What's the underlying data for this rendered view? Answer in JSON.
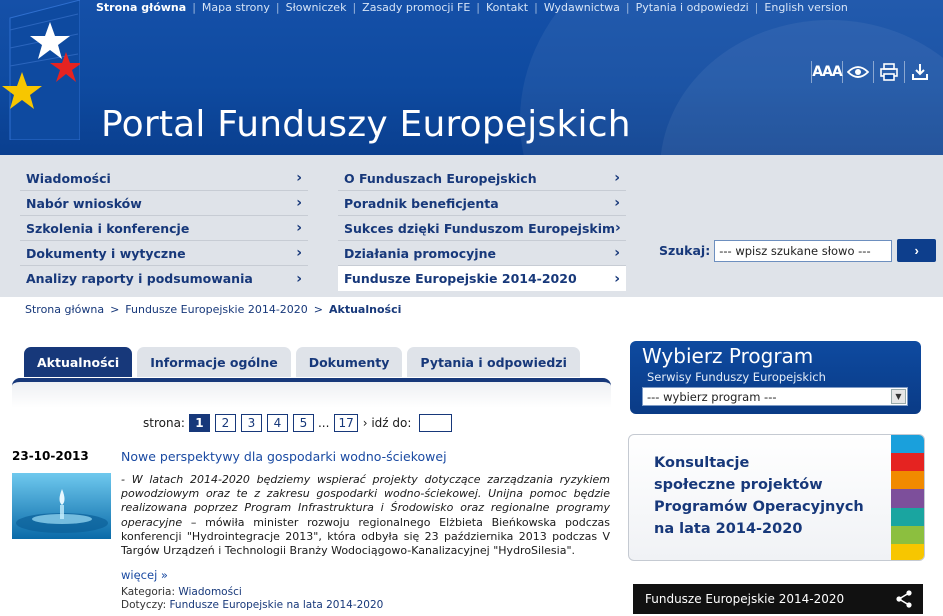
{
  "topnav": {
    "items": [
      "Strona główna",
      "Mapa strony",
      "Słowniczek",
      "Zasady promocji FE",
      "Kontakt",
      "Wydawnictwa",
      "Pytania i odpowiedzi",
      "English version"
    ]
  },
  "header": {
    "title": "Portal Funduszy Europejskich",
    "tools": {
      "font_size_label": "AAA",
      "icons": [
        "font-size-icon",
        "eye-icon",
        "print-icon",
        "download-icon"
      ]
    }
  },
  "menu": {
    "left": [
      "Wiadomości",
      "Nabór wniosków",
      "Szkolenia i konferencje",
      "Dokumenty i wytyczne",
      "Analizy raporty i podsumowania"
    ],
    "right": [
      "O Funduszach Europejskich",
      "Poradnik beneficjenta",
      "Sukces dzięki Funduszom Europejskim",
      "Działania promocyjne",
      "Fundusze Europejskie 2014-2020"
    ],
    "chevron": "›",
    "active_right_index": 4
  },
  "search": {
    "label": "Szukaj:",
    "value": "--- wpisz szukane słowo ---",
    "button": "›"
  },
  "breadcrumb": {
    "items": [
      "Strona główna",
      "Fundusze Europejskie 2014-2020",
      "Aktualności"
    ],
    "separator": ">"
  },
  "tabs": [
    "Aktualności",
    "Informacje ogólne",
    "Dokumenty",
    "Pytania i odpowiedzi"
  ],
  "pager": {
    "label": "strona:",
    "pages": [
      "1",
      "2",
      "3",
      "4",
      "5"
    ],
    "ellipsis": "...",
    "last": "17",
    "goto_label": "› idź do:"
  },
  "article": {
    "date": "23-10-2013",
    "title": "Nowe perspektywy dla gospodarki wodno-ściekowej",
    "quote": "- W latach 2014-2020 będziemy wspierać projekty dotyczące zarządzania ryzykiem powodziowym oraz te z zakresu gospodarki wodno-ściekowej. Unijna pomoc będzie realizowana poprzez Program Infrastruktura i Środowisko oraz regionalne programy operacyjne",
    "rest": " – mówiła minister rozwoju regionalnego Elżbieta Bieńkowska podczas konferencji \"Hydrointegracje 2013\", która odbyła się 23 października 2013 podczas V Targów Urządzeń i Technologii Branży Wodociągowo-Kanalizacyjnej \"HydroSilesia\".",
    "more": "więcej »",
    "category_label": "Kategoria:",
    "category": "Wiadomości",
    "concerns_label": "Dotyczy:",
    "concerns": "Fundusze Europejskie na lata 2014-2020"
  },
  "program_box": {
    "title": "Wybierz Program",
    "subtitle": "Serwisy Funduszy Europejskich",
    "select_value": "--- wybierz program ---"
  },
  "consult_box": {
    "line1": "Konsultacje",
    "line2": "społeczne projektów",
    "line3": "Programów Operacyjnych",
    "line4": "na lata 2014-2020",
    "stripe_colors": [
      "#1aa0dc",
      "#e52321",
      "#f18a00",
      "#7d4f9b",
      "#1aa5a0",
      "#8cbf3f",
      "#f7c600"
    ]
  },
  "fe_bar": {
    "label": "Fundusze Europejskie 2014-2020"
  },
  "colors": {
    "navy": "#17387a",
    "header_blue": "#0e4aa0",
    "menu_bg": "#dfe3e9"
  }
}
